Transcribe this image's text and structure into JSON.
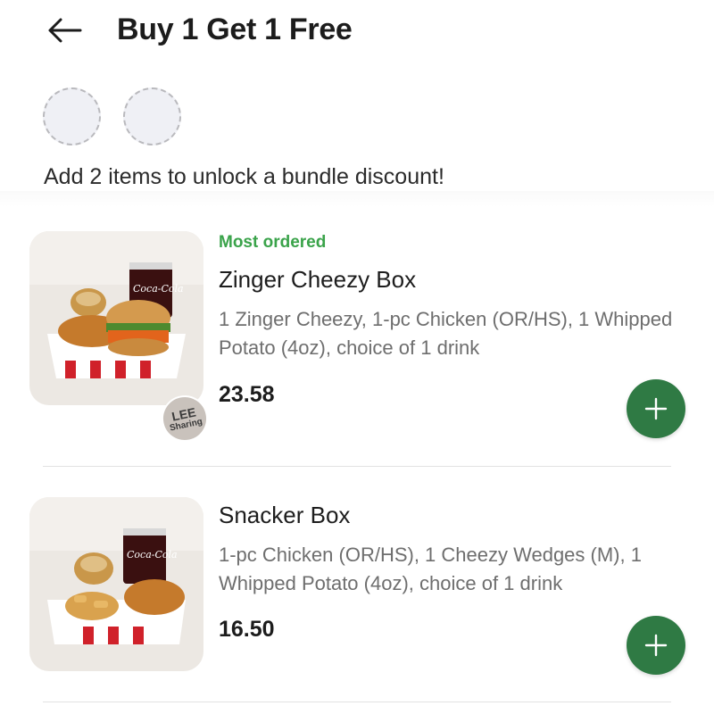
{
  "header": {
    "title": "Buy 1 Get 1 Free",
    "back_icon": "arrow-left-icon"
  },
  "bundle": {
    "slots_total": 2,
    "hint": "Add 2 items to unlock a bundle discount!"
  },
  "products": [
    {
      "tag": "Most ordered",
      "name": "Zinger Cheezy Box",
      "description": "1 Zinger Cheezy, 1-pc Chicken (OR/HS), 1 Whipped Potato (4oz), choice of 1 drink",
      "price": "23.58",
      "badge": {
        "line1": "LEE",
        "line2": "Sharing"
      }
    },
    {
      "name": "Snacker Box",
      "description": "1-pc Chicken (OR/HS), 1 Cheezy Wedges (M), 1 Whipped Potato (4oz), choice of 1 drink",
      "price": "16.50"
    }
  ],
  "colors": {
    "accent_green": "#2f7a44",
    "tag_green": "#3aa34a"
  }
}
